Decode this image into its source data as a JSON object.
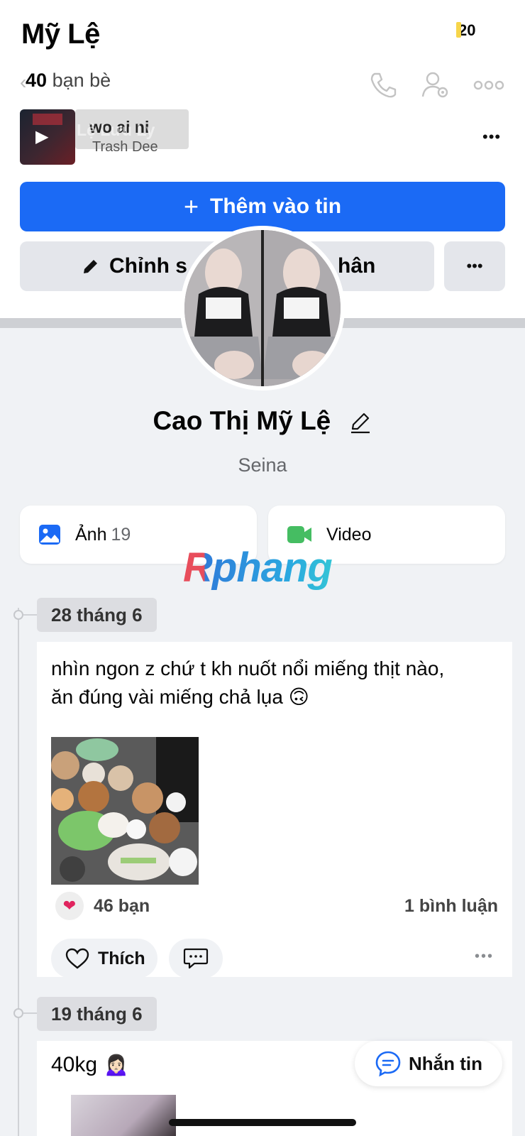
{
  "header": {
    "display_name": "Mỹ Lệ",
    "badge_count": "20",
    "friends_count": "40",
    "friends_label": "bạn bè"
  },
  "music": {
    "title": "wo ai ni",
    "title_overlay": "Lệ Lưu Ly",
    "artist": "Trash Dee"
  },
  "actions": {
    "add_story": "Thêm vào tin",
    "edit_profile_prefix": "Chỉnh s",
    "edit_profile_suffix": "hân"
  },
  "profile": {
    "full_name": "Cao Thị Mỹ Lệ",
    "nickname": "Seina"
  },
  "media": {
    "photos_label": "Ảnh",
    "photos_count": "19",
    "video_label": "Video"
  },
  "watermark": "Rphang",
  "posts": [
    {
      "date": "28 tháng 6",
      "text_line1": "nhìn ngon z chứ t kh nuốt nổi miếng thịt nào,",
      "text_line2": "ăn đúng vài miếng chả lụa 🙃",
      "reactions": "46 bạn",
      "comments": "1 bình luận",
      "like_label": "Thích"
    },
    {
      "date": "19 tháng 6",
      "text": "40kg 🙍🏻‍♀️"
    }
  ],
  "fab": {
    "label": "Nhắn tin"
  },
  "colors": {
    "primary": "#1b6af5",
    "video_icon": "#45bd62",
    "photo_icon": "#1b6af5",
    "heart": "#e0245e"
  }
}
